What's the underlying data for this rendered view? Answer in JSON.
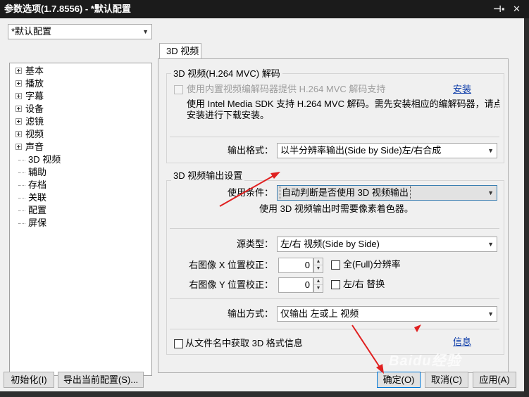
{
  "window": {
    "title": "参数选项(1.7.8556) - *默认配置",
    "pin_icon": "pin-icon",
    "close_icon": "close-icon"
  },
  "profile_select": {
    "value": "*默认配置"
  },
  "tree": {
    "items": [
      {
        "label": "基本",
        "expandable": true
      },
      {
        "label": "播放",
        "expandable": true
      },
      {
        "label": "字幕",
        "expandable": true
      },
      {
        "label": "设备",
        "expandable": true
      },
      {
        "label": "滤镜",
        "expandable": true
      },
      {
        "label": "视频",
        "expandable": true
      },
      {
        "label": "声音",
        "expandable": true
      },
      {
        "label": "3D 视频",
        "expandable": false
      },
      {
        "label": "辅助",
        "expandable": false
      },
      {
        "label": "存档",
        "expandable": false
      },
      {
        "label": "关联",
        "expandable": false
      },
      {
        "label": "配置",
        "expandable": false
      },
      {
        "label": "屏保",
        "expandable": false
      }
    ]
  },
  "tab": {
    "label": "3D 视频"
  },
  "mvc_group": {
    "title": "3D 视频(H.264 MVC) 解码",
    "use_builtin_label": "使用内置视频编解码器提供 H.264 MVC 解码支持",
    "use_builtin_checked": false,
    "install_link": "安装",
    "desc_line1": "使用 Intel Media SDK 支持 H.264 MVC 解码。需先安装相应的编解码器，请点击'",
    "desc_line2": "安装进行下载安装。",
    "output_format_label": "输出格式：",
    "output_format_value": "以半分辨率输出(Side by Side)左/右合成"
  },
  "output_group": {
    "title": "3D 视频输出设置",
    "condition_label": "使用条件：",
    "condition_value": "自动判断是否使用 3D 视频输出",
    "condition_note": "使用 3D 视频输出时需要像素着色器。",
    "source_type_label": "源类型：",
    "source_type_value": "左/右 视频(Side by Side)",
    "right_x_label": "右图像 X 位置校正：",
    "right_x_value": "0",
    "right_y_label": "右图像 Y 位置校正：",
    "right_y_value": "0",
    "full_res_label": "全(Full)分辨率",
    "full_res_checked": false,
    "swap_label": "左/右 替换",
    "swap_checked": false,
    "output_mode_label": "输出方式：",
    "output_mode_value": "仅输出 左或上 视频"
  },
  "filename_detect": {
    "label": "从文件名中获取 3D 格式信息",
    "checked": false
  },
  "info_link": "信息",
  "buttons": {
    "init": "初始化(I)",
    "export": "导出当前配置(S)...",
    "ok": "确定(O)",
    "cancel": "取消(C)",
    "apply": "应用(A)"
  },
  "watermark": "Baidu经验",
  "colors": {
    "annotation_arrow": "#e02020",
    "link": "#0a3aa8",
    "focus_border": "#0078d7"
  }
}
